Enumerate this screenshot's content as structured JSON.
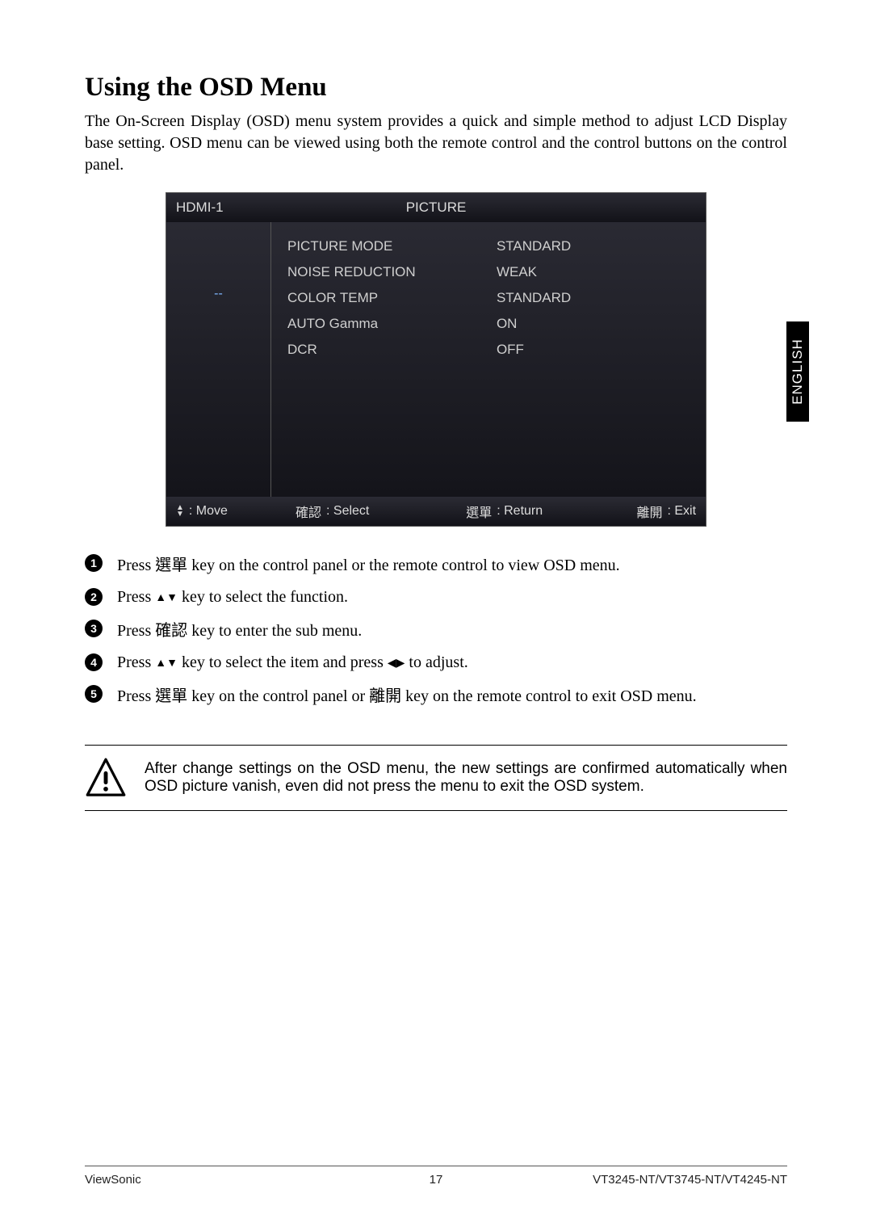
{
  "heading": "Using the OSD Menu",
  "intro": "The On-Screen Display (OSD) menu system provides a quick and simple method to adjust LCD Display base setting. OSD menu can be viewed using both the remote control and the control buttons on the control panel.",
  "osd": {
    "header_source": "HDMI-1",
    "header_title": "PICTURE",
    "side_dash": "--",
    "rows": [
      {
        "label": "PICTURE MODE",
        "value": "STANDARD"
      },
      {
        "label": "NOISE REDUCTION",
        "value": "WEAK"
      },
      {
        "label": "COLOR TEMP",
        "value": "STANDARD"
      },
      {
        "label": "AUTO Gamma",
        "value": "ON"
      },
      {
        "label": "DCR",
        "value": "OFF"
      }
    ],
    "footer": {
      "move_label": ": Move",
      "select_cjk": "確認",
      "select_label": ": Select",
      "return_cjk": "選單",
      "return_label": ": Return",
      "exit_cjk": "離開",
      "exit_label": ": Exit"
    }
  },
  "steps": [
    {
      "n": "1",
      "pre": "Press ",
      "cjk1": "選單",
      "mid": " key on the control panel or the remote control to view OSD menu."
    },
    {
      "n": "2",
      "pre": "Press ",
      "tri": "▲▼",
      "mid": " key to select the function."
    },
    {
      "n": "3",
      "pre": "Press ",
      "cjk1": "確認",
      "mid": " key to enter the sub menu."
    },
    {
      "n": "4",
      "pre": "Press ",
      "tri": "▲▼",
      "mid": " key to select the item and press ",
      "tri2": "◀▶",
      "post": " to adjust."
    },
    {
      "n": "5",
      "pre": "Press ",
      "cjk1": "選單",
      "mid": " key on the control panel or ",
      "cjk2": "離開",
      "post": " key on the remote control to exit OSD menu."
    }
  ],
  "notice": "After change settings on the OSD menu, the new settings are confirmed automatically when OSD picture vanish, even did not press the menu to exit the OSD system.",
  "side_tab": "ENGLISH",
  "footer": {
    "left": "ViewSonic",
    "center": "17",
    "right": "VT3245-NT/VT3745-NT/VT4245-NT"
  }
}
